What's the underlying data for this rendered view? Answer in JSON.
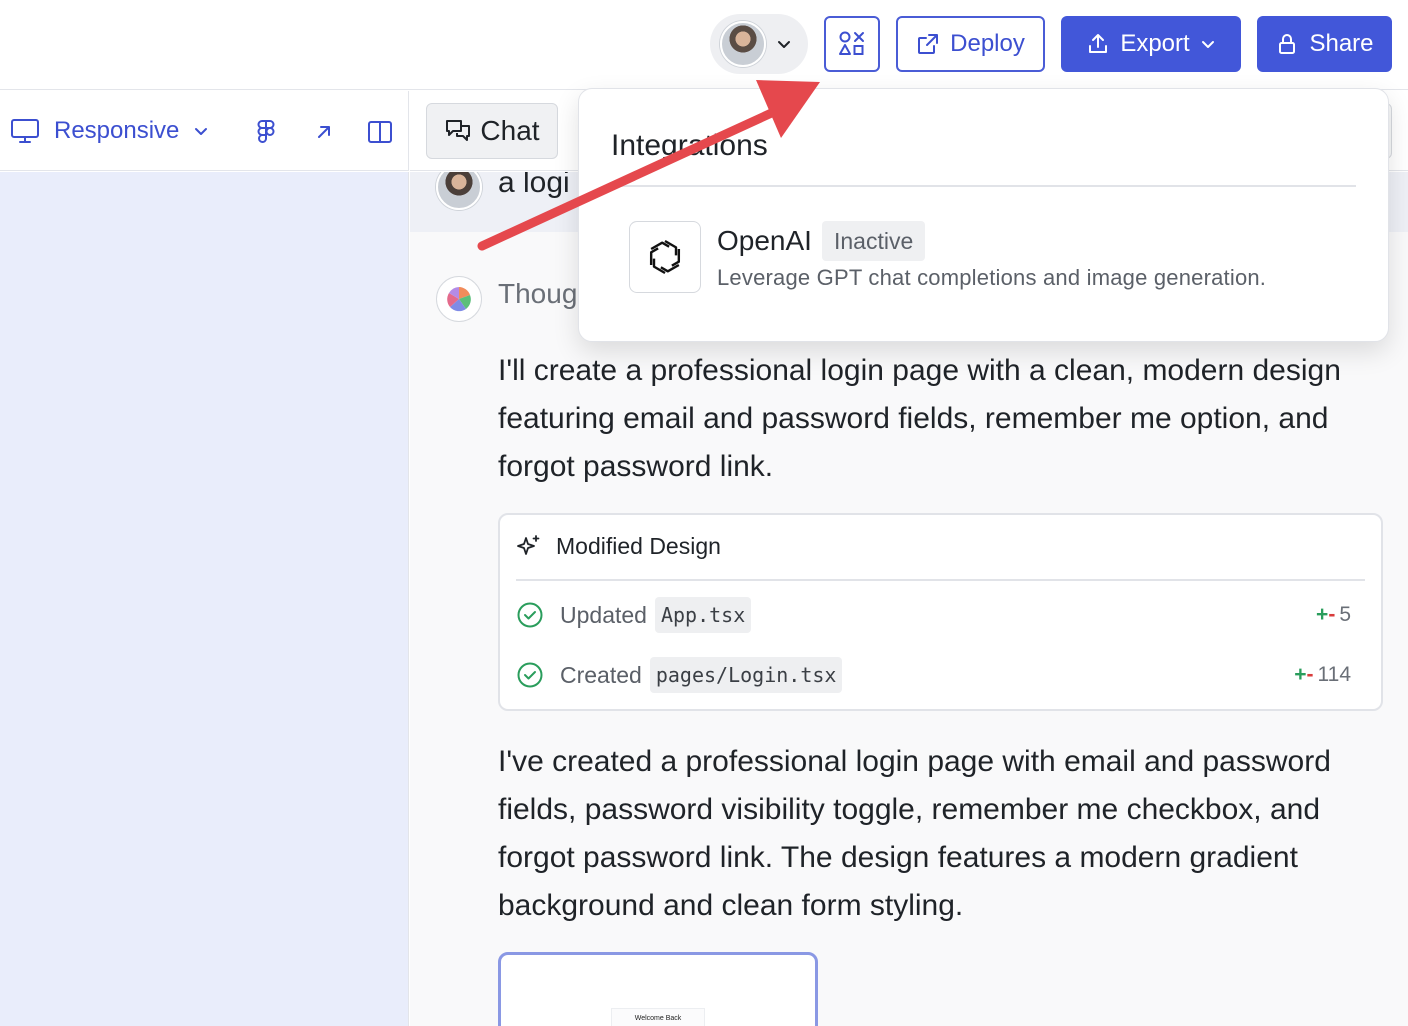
{
  "toolbar": {
    "deploy_label": "Deploy",
    "export_label": "Export",
    "share_label": "Share"
  },
  "subbar": {
    "responsive_label": "Responsive",
    "chat_tab_label": "Chat"
  },
  "chat": {
    "user_message_visible": "a logi",
    "thought_label_visible": "Thoug",
    "message1": "I'll create a professional login page with a clean, modern design featuring email and password fields, remember me option, and forgot password link.",
    "modified_design": {
      "title": "Modified Design",
      "rows": [
        {
          "verb": "Updated",
          "file": "App.tsx",
          "plus": "+",
          "minus": "-",
          "count": "5"
        },
        {
          "verb": "Created",
          "file": "pages/Login.tsx",
          "plus": "+",
          "minus": "-",
          "count": "114"
        }
      ]
    },
    "message2": "I've created a professional login page with email and password fields, password visibility toggle, remember me checkbox, and forgot password link. The design features a modern gradient background and clean form styling.",
    "preview_title": "Welcome Back"
  },
  "integrations": {
    "title": "Integrations",
    "items": [
      {
        "name": "OpenAI",
        "status": "Inactive",
        "description": "Leverage GPT chat completions and image generation."
      }
    ]
  },
  "colors": {
    "accent": "#4257d9",
    "annotation_arrow": "#e5484d",
    "canvas_bg": "#e9edfb"
  }
}
